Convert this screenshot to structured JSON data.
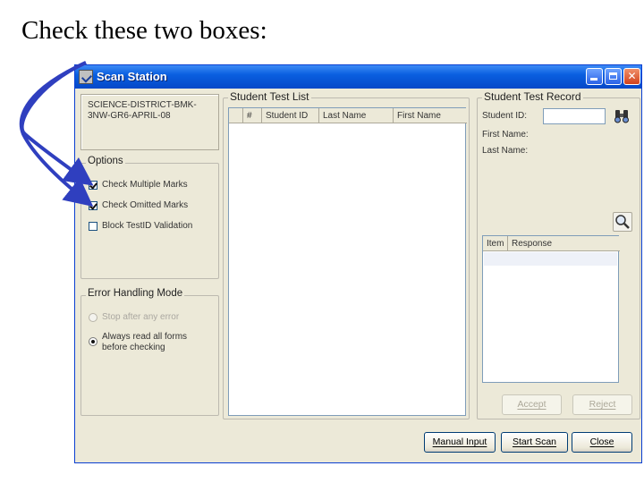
{
  "slide": {
    "title": "Check these two boxes:"
  },
  "window": {
    "title": "Scan Station"
  },
  "test_info": {
    "text": "SCIENCE-DISTRICT-BMK-\n3NW-GR6-APRIL-08"
  },
  "options": {
    "legend": "Options",
    "items": [
      {
        "label": "Check Multiple Marks",
        "checked": true
      },
      {
        "label": "Check Omitted Marks",
        "checked": true
      },
      {
        "label": "Block TestID Validation",
        "checked": false
      }
    ]
  },
  "error_handling": {
    "legend": "Error Handling Mode",
    "items": [
      {
        "label": "Stop after any error",
        "selected": false,
        "enabled": false
      },
      {
        "label": "Always read all forms\nbefore checking",
        "selected": true,
        "enabled": true
      }
    ]
  },
  "student_test_list": {
    "legend": "Student Test List",
    "columns": [
      "#",
      "Student ID",
      "Last Name",
      "First Name"
    ]
  },
  "student_test_record": {
    "legend": "Student Test Record",
    "student_id_label": "Student ID:",
    "first_name_label": "First Name:",
    "last_name_label": "Last Name:",
    "columns": [
      "Item",
      "Response"
    ],
    "accept_label": "Accept",
    "reject_label": "Reject"
  },
  "buttons": {
    "manual_input": "Manual Input",
    "start_scan": "Start Scan",
    "close": "Close"
  },
  "colors": {
    "titlebar": "#0a5fe0",
    "window_bg": "#ece9d8",
    "arrow": "#2f3fbf"
  }
}
